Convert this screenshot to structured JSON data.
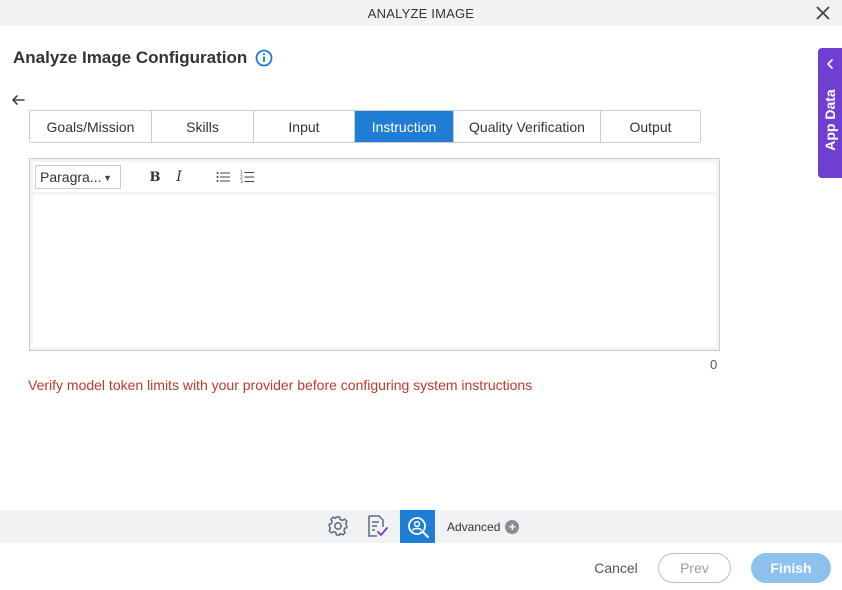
{
  "window": {
    "title": "ANALYZE IMAGE"
  },
  "page": {
    "title": "Analyze Image Configuration"
  },
  "tabs": [
    {
      "label": "Goals/Mission",
      "active": false
    },
    {
      "label": "Skills",
      "active": false
    },
    {
      "label": "Input",
      "active": false
    },
    {
      "label": "Instruction",
      "active": true
    },
    {
      "label": "Quality Verification",
      "active": false
    },
    {
      "label": "Output",
      "active": false
    }
  ],
  "editor": {
    "paragraph_select": "Paragra...",
    "bold_label": "B",
    "italic_label": "I",
    "content": "",
    "char_count": "0"
  },
  "warning_text": "Verify model token limits with your provider before configuring system instructions",
  "side_panel": {
    "label": "App Data"
  },
  "bottom_bar": {
    "advanced_label": "Advanced"
  },
  "footer": {
    "cancel_label": "Cancel",
    "prev_label": "Prev",
    "finish_label": "Finish"
  },
  "colors": {
    "accent": "#1f7ed3",
    "side_panel": "#6e3fd1",
    "warning": "#c0392b",
    "finish_disabled": "#8ec2ee"
  },
  "icons": [
    "close-icon",
    "info-icon",
    "back-arrow-icon",
    "bullet-list-icon",
    "numbered-list-icon",
    "chevron-left-icon",
    "settings-icon",
    "document-check-icon",
    "image-search-icon",
    "plus-circle-icon"
  ]
}
